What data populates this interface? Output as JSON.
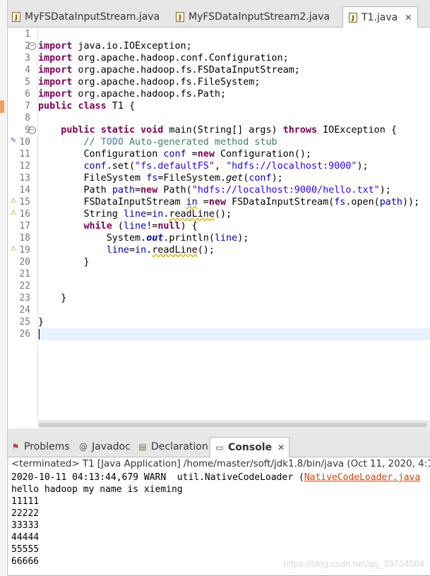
{
  "editor_tabs": [
    {
      "label": "MyFSDataInputStream.java",
      "active": false
    },
    {
      "label": "MyFSDataInputStream2.java",
      "active": false
    },
    {
      "label": "T1.java",
      "active": true,
      "close": "✕"
    }
  ],
  "code_lines": [
    {
      "n": "1",
      "text": ""
    },
    {
      "n": "2",
      "text": "import java.io.IOException;"
    },
    {
      "n": "3",
      "text": "import org.apache.hadoop.conf.Configuration;"
    },
    {
      "n": "4",
      "text": "import org.apache.hadoop.fs.FSDataInputStream;"
    },
    {
      "n": "5",
      "text": "import org.apache.hadoop.fs.FileSystem;"
    },
    {
      "n": "6",
      "text": "import org.apache.hadoop.fs.Path;"
    },
    {
      "n": "7",
      "text": "public class T1 {"
    },
    {
      "n": "8",
      "text": ""
    },
    {
      "n": "9",
      "text": "    public static void main(String[] args) throws IOException {"
    },
    {
      "n": "10",
      "text": "        // TODO Auto-generated method stub"
    },
    {
      "n": "11",
      "text": "        Configuration conf =new Configuration();"
    },
    {
      "n": "12",
      "text": "        conf.set(\"fs.defaultFS\", \"hdfs://localhost:9000\");"
    },
    {
      "n": "13",
      "text": "        FileSystem fs=FileSystem.get(conf);"
    },
    {
      "n": "14",
      "text": "        Path path=new Path(\"hdfs://localhost:9000/hello.txt\");"
    },
    {
      "n": "15",
      "text": "        FSDataInputStream in =new FSDataInputStream(fs.open(path));"
    },
    {
      "n": "16",
      "text": "        String line=in.readLine();"
    },
    {
      "n": "17",
      "text": "        while (line!=null) {"
    },
    {
      "n": "18",
      "text": "            System.out.println(line);"
    },
    {
      "n": "19",
      "text": "            line=in.readLine();"
    },
    {
      "n": "20",
      "text": "        }"
    },
    {
      "n": "21",
      "text": ""
    },
    {
      "n": "22",
      "text": ""
    },
    {
      "n": "23",
      "text": "    }"
    },
    {
      "n": "24",
      "text": ""
    },
    {
      "n": "25",
      "text": "}"
    },
    {
      "n": "26",
      "text": ""
    }
  ],
  "view_tabs": [
    {
      "label": "Problems",
      "icon": "problems-icon",
      "active": false
    },
    {
      "label": "Javadoc",
      "icon": "javadoc-icon",
      "active": false
    },
    {
      "label": "Declaration",
      "icon": "declaration-icon",
      "active": false
    },
    {
      "label": "Console",
      "icon": "console-icon",
      "active": true,
      "close": "✕"
    }
  ],
  "console": {
    "description": "<terminated> T1 [Java Application] /home/master/soft/jdk1.8/bin/java (Oct 11, 2020, 4:1",
    "warn_line_prefix": "2020-10-11 04:13:44,679 WARN  util.NativeCodeLoader (",
    "warn_line_link": "NativeCodeLoader.java",
    "output": [
      "hello hadoop my name is xieming",
      "11111",
      "22222",
      "33333",
      "44444",
      "55555",
      "66666"
    ]
  },
  "watermark": "https://blog.csdn.net/qq_39734584",
  "colors": {
    "keyword": "#7f0055",
    "string": "#2a00ff",
    "comment": "#3f7f5f",
    "field": "#0000c0",
    "link": "#e04000"
  }
}
